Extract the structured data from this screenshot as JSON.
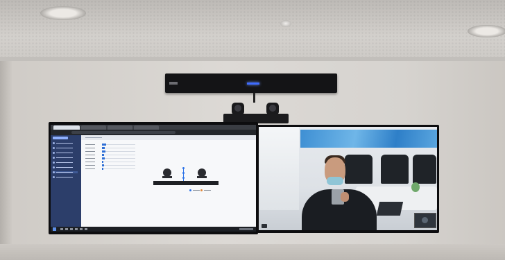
{
  "scene": {
    "description_colors": {
      "soundbar_led": "#3f6cff",
      "app_sidebar": "#2c3e6a",
      "diagram_accent": "#2d73e8",
      "vc_art": "#3e8fd3"
    }
  },
  "left_display": {
    "sidebar_items": 9,
    "list_rows": [
      {
        "fill": 0.12
      },
      {
        "fill": 0.08
      },
      {
        "fill": 0.1
      },
      {
        "fill": 0.06
      },
      {
        "fill": 0.09
      },
      {
        "fill": 0.05
      },
      {
        "fill": 0.07
      },
      {
        "fill": 0.04
      }
    ],
    "icons": [
      "camera-icon",
      "camera-icon",
      "sound-bar-icon"
    ],
    "legend_colors": [
      "#2d73e8",
      "#e2893a"
    ]
  },
  "right_display": {
    "icons": [
      "self-view-icon",
      "call-status-icon"
    ]
  }
}
